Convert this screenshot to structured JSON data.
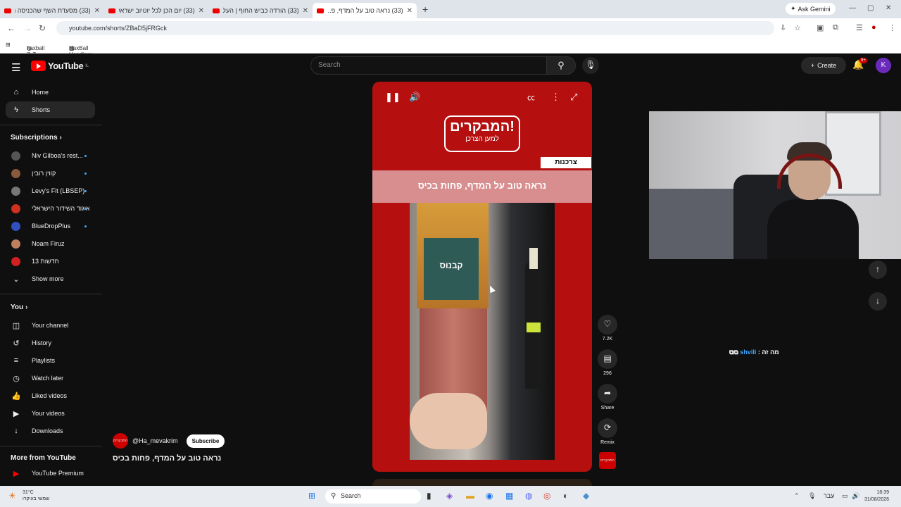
{
  "browser": {
    "tabs": [
      {
        "title": "(33) מסעדת השף שהכניסה נוק"
      },
      {
        "title": "(33) יום הכן לכל יוטיוב ישראלי!"
      },
      {
        "title": "(33) הורדה כביש החוף | העלות"
      },
      {
        "title": "(33) נראה טוב על המדף, פ..."
      }
    ],
    "ask_gemini": "Ask Gemini",
    "url": "youtube.com/shorts/ZBaD5jFRGck",
    "bookmarks": [
      "haxball 7x7",
      "HaxBall Headless H..."
    ]
  },
  "header": {
    "logo_text": "YouTube",
    "logo_region": "IL",
    "search_placeholder": "Search",
    "create_label": "Create",
    "notif_badge": "9+",
    "account_initial": "K"
  },
  "sidebar": {
    "main": [
      {
        "label": "Home",
        "icon": "home-icon"
      },
      {
        "label": "Shorts",
        "icon": "shorts-icon"
      }
    ],
    "subscriptions_title": "Subscriptions",
    "subscriptions": [
      {
        "label": "Niv Gilboa's rest...",
        "color": "#555555"
      },
      {
        "label": "קווין רובין",
        "color": "#8a5a3c"
      },
      {
        "label": "Levy's Fit (LBSEP)",
        "color": "#777777"
      },
      {
        "label": "איגוד השידור הישראלי",
        "color": "#d03020"
      },
      {
        "label": "BlueDropPlus",
        "color": "#3050c0"
      },
      {
        "label": "Noam Firuz",
        "color": "#c08060"
      },
      {
        "label": "חדשות 13",
        "color": "#d02020"
      }
    ],
    "show_more": "Show more",
    "you_title": "You",
    "you_items": [
      {
        "label": "Your channel",
        "icon": "channel-icon"
      },
      {
        "label": "History",
        "icon": "history-icon"
      },
      {
        "label": "Playlists",
        "icon": "playlists-icon"
      },
      {
        "label": "Watch later",
        "icon": "watch-later-icon"
      },
      {
        "label": "Liked videos",
        "icon": "like-icon"
      },
      {
        "label": "Your videos",
        "icon": "video-icon"
      },
      {
        "label": "Downloads",
        "icon": "download-icon"
      }
    ],
    "more_title": "More from YouTube",
    "premium": "YouTube Premium"
  },
  "short": {
    "brand_main": "המבקרים!",
    "brand_sub": "למען הצרכן",
    "tag": "צרכנות",
    "headline": "נראה טוב על המדף, פחות בכיס",
    "pack_label": "קבנוס",
    "channel": "@Ha_mevakrim",
    "channel_avatar_text": "המבקרים",
    "subscribe": "Subscribe",
    "title": "נראה טוב על המדף, פחות בכיס"
  },
  "actions": {
    "likes": "7.2K",
    "comments": "296",
    "share": "Share",
    "remix": "Remix"
  },
  "chat": {
    "user": "shvili",
    "message": ": מה זה"
  },
  "taskbar": {
    "weather_temp": "31°C",
    "weather_desc": "שמשי בעיקרו",
    "search": "Search",
    "lang": "עבר",
    "time": "18:39",
    "date": "31/08/2026"
  }
}
